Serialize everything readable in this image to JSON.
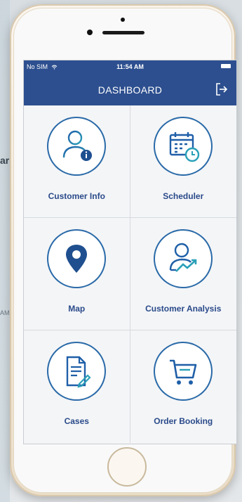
{
  "background": {
    "side_text": "ar",
    "side_text2": "AM"
  },
  "status_bar": {
    "carrier": "No SIM",
    "time": "11:54 AM"
  },
  "header": {
    "title": "DASHBOARD",
    "logout_icon": "logout-icon"
  },
  "tiles": [
    {
      "label": "Customer Info",
      "icon": "customer-info-icon"
    },
    {
      "label": "Scheduler",
      "icon": "calendar-clock-icon"
    },
    {
      "label": "Map",
      "icon": "map-pin-icon"
    },
    {
      "label": "Customer Analysis",
      "icon": "customer-analysis-icon"
    },
    {
      "label": "Cases",
      "icon": "document-edit-icon"
    },
    {
      "label": "Order Booking",
      "icon": "cart-icon"
    }
  ],
  "colors": {
    "header": "#2d4f8f",
    "accent": "#2a6aa8",
    "label": "#2a4a8a"
  }
}
